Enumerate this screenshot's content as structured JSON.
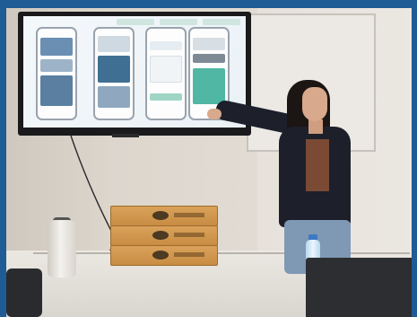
{
  "scene": {
    "description_tags": [
      "presenter",
      "tv-screen",
      "pizza-boxes",
      "thermos",
      "laptop",
      "whiteboard"
    ],
    "colors": {
      "border": "#1f5b95",
      "jacket": "#1d1f2b",
      "box": "#d9a25a",
      "screen_bg": "#f4f8fb"
    },
    "phones": [
      {
        "accent": "#6a8fb3"
      },
      {
        "accent": "#3f6f92"
      },
      {
        "accent": "#9fd5c5"
      },
      {
        "accent": "#4fb7a3"
      }
    ],
    "box_count": 3
  }
}
